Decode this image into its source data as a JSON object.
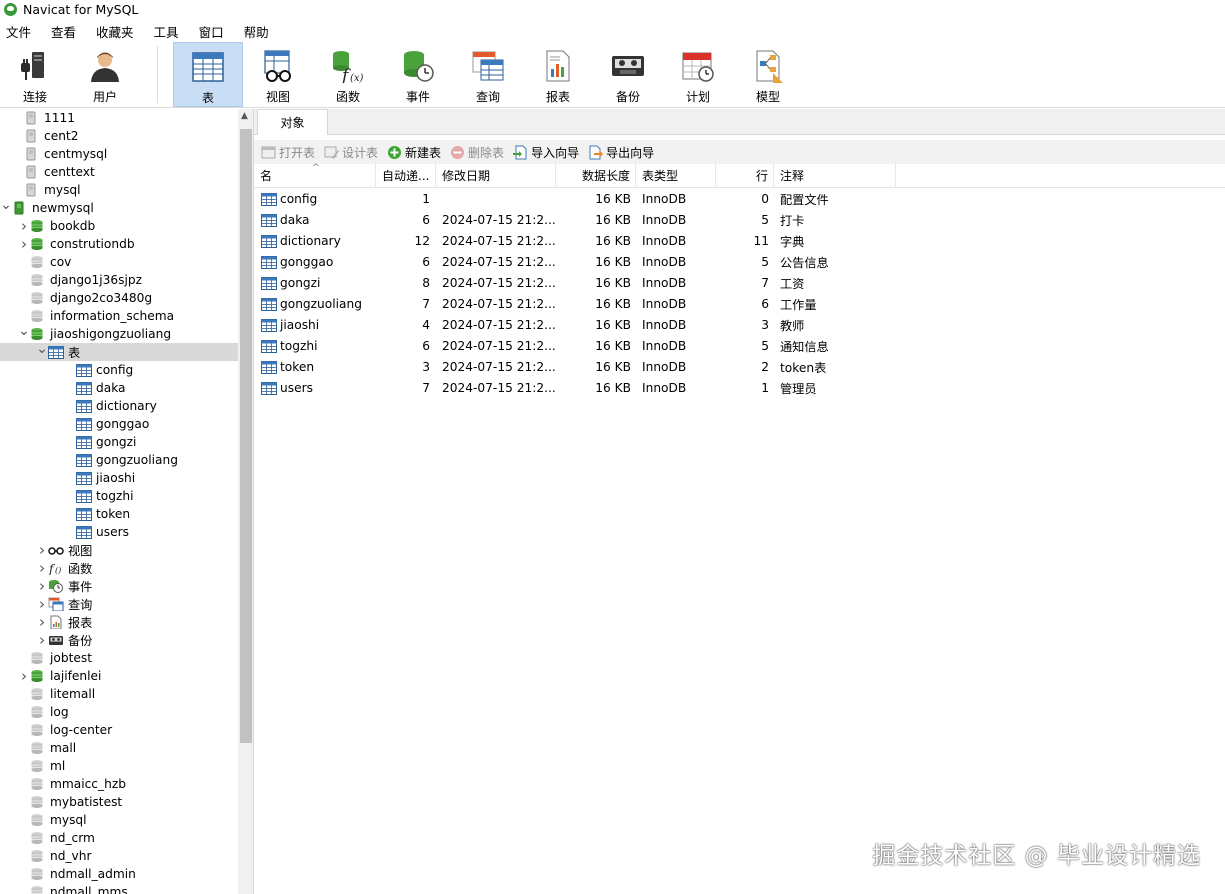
{
  "window": {
    "title": "Navicat for MySQL"
  },
  "menubar": [
    "文件",
    "查看",
    "收藏夹",
    "工具",
    "窗口",
    "帮助"
  ],
  "toolbar": {
    "items": [
      {
        "label": "连接",
        "icon": "connect-icon"
      },
      {
        "label": "用户",
        "icon": "user-icon"
      },
      {
        "label": "表",
        "icon": "table-icon",
        "active": true
      },
      {
        "label": "视图",
        "icon": "view-icon"
      },
      {
        "label": "函数",
        "icon": "function-icon"
      },
      {
        "label": "事件",
        "icon": "event-icon"
      },
      {
        "label": "查询",
        "icon": "query-icon"
      },
      {
        "label": "报表",
        "icon": "report-icon"
      },
      {
        "label": "备份",
        "icon": "backup-icon"
      },
      {
        "label": "计划",
        "icon": "schedule-icon"
      },
      {
        "label": "模型",
        "icon": "model-icon"
      }
    ]
  },
  "sidebar": {
    "connections_top": [
      "1111",
      "cent2",
      "centmysql",
      "centtext",
      "mysql"
    ],
    "open_connection": "newmysql",
    "db_before": [
      {
        "name": "bookdb",
        "open": true,
        "expandable": true
      },
      {
        "name": "construtiondb",
        "open": true,
        "expandable": true
      },
      {
        "name": "cov",
        "open": false,
        "expandable": false
      },
      {
        "name": "django1j36sjpz",
        "open": false,
        "expandable": false
      },
      {
        "name": "django2co3480g",
        "open": false,
        "expandable": false
      },
      {
        "name": "information_schema",
        "open": false,
        "expandable": false
      }
    ],
    "open_db": "jiaoshigongzuoliang",
    "tables_node": "表",
    "tables": [
      "config",
      "daka",
      "dictionary",
      "gonggao",
      "gongzi",
      "gongzuoliang",
      "jiaoshi",
      "togzhi",
      "token",
      "users"
    ],
    "other_nodes": [
      {
        "label": "视图",
        "icon": "view-icon"
      },
      {
        "label": "函数",
        "icon": "function-icon"
      },
      {
        "label": "事件",
        "icon": "event-icon"
      },
      {
        "label": "查询",
        "icon": "query-icon"
      },
      {
        "label": "报表",
        "icon": "report-icon"
      },
      {
        "label": "备份",
        "icon": "backup-icon"
      }
    ],
    "db_after": [
      {
        "name": "jobtest",
        "open": false,
        "expandable": false
      },
      {
        "name": "lajifenlei",
        "open": true,
        "expandable": true
      },
      {
        "name": "litemall",
        "open": false,
        "expandable": false
      },
      {
        "name": "log",
        "open": false,
        "expandable": false
      },
      {
        "name": "log-center",
        "open": false,
        "expandable": false
      },
      {
        "name": "mall",
        "open": false,
        "expandable": false
      },
      {
        "name": "ml",
        "open": false,
        "expandable": false
      },
      {
        "name": "mmaicc_hzb",
        "open": false,
        "expandable": false
      },
      {
        "name": "mybatistest",
        "open": false,
        "expandable": false
      },
      {
        "name": "mysql",
        "open": false,
        "expandable": false
      },
      {
        "name": "nd_crm",
        "open": false,
        "expandable": false
      },
      {
        "name": "nd_vhr",
        "open": false,
        "expandable": false
      },
      {
        "name": "ndmall_admin",
        "open": false,
        "expandable": false
      },
      {
        "name": "ndmall_mms",
        "open": false,
        "expandable": false
      }
    ]
  },
  "tab": {
    "label": "对象"
  },
  "object_toolbar": [
    {
      "label": "打开表",
      "disabled": true,
      "icon": "open-table-icon"
    },
    {
      "label": "设计表",
      "disabled": true,
      "icon": "design-table-icon"
    },
    {
      "label": "新建表",
      "disabled": false,
      "icon": "new-table-icon"
    },
    {
      "label": "删除表",
      "disabled": true,
      "icon": "delete-table-icon"
    },
    {
      "label": "导入向导",
      "disabled": false,
      "icon": "import-wizard-icon"
    },
    {
      "label": "导出向导",
      "disabled": false,
      "icon": "export-wizard-icon"
    }
  ],
  "grid": {
    "headers": [
      "名",
      "自动递...",
      "修改日期",
      "数据长度",
      "表类型",
      "行",
      "注释"
    ],
    "rows": [
      {
        "name": "config",
        "auto": "1",
        "date": "",
        "size": "16 KB",
        "engine": "InnoDB",
        "rows": "0",
        "comment": "配置文件"
      },
      {
        "name": "daka",
        "auto": "6",
        "date": "2024-07-15 21:2...",
        "size": "16 KB",
        "engine": "InnoDB",
        "rows": "5",
        "comment": "打卡"
      },
      {
        "name": "dictionary",
        "auto": "12",
        "date": "2024-07-15 21:2...",
        "size": "16 KB",
        "engine": "InnoDB",
        "rows": "11",
        "comment": "字典"
      },
      {
        "name": "gonggao",
        "auto": "6",
        "date": "2024-07-15 21:2...",
        "size": "16 KB",
        "engine": "InnoDB",
        "rows": "5",
        "comment": "公告信息"
      },
      {
        "name": "gongzi",
        "auto": "8",
        "date": "2024-07-15 21:2...",
        "size": "16 KB",
        "engine": "InnoDB",
        "rows": "7",
        "comment": "工资"
      },
      {
        "name": "gongzuoliang",
        "auto": "7",
        "date": "2024-07-15 21:2...",
        "size": "16 KB",
        "engine": "InnoDB",
        "rows": "6",
        "comment": "工作量"
      },
      {
        "name": "jiaoshi",
        "auto": "4",
        "date": "2024-07-15 21:2...",
        "size": "16 KB",
        "engine": "InnoDB",
        "rows": "3",
        "comment": "教师"
      },
      {
        "name": "togzhi",
        "auto": "6",
        "date": "2024-07-15 21:2...",
        "size": "16 KB",
        "engine": "InnoDB",
        "rows": "5",
        "comment": "通知信息"
      },
      {
        "name": "token",
        "auto": "3",
        "date": "2024-07-15 21:2...",
        "size": "16 KB",
        "engine": "InnoDB",
        "rows": "2",
        "comment": "token表"
      },
      {
        "name": "users",
        "auto": "7",
        "date": "2024-07-15 21:2...",
        "size": "16 KB",
        "engine": "InnoDB",
        "rows": "1",
        "comment": "管理员"
      }
    ]
  },
  "watermark": "掘金技术社区 @ 毕业设计精选"
}
